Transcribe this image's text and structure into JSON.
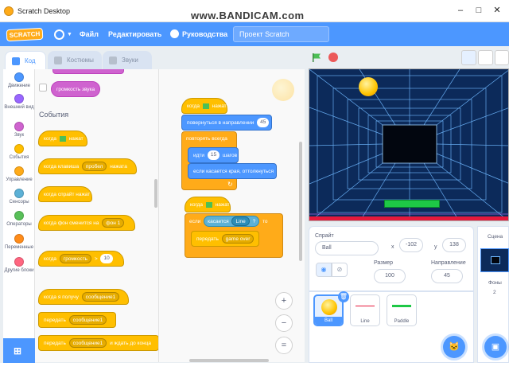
{
  "window": {
    "title": "Scratch Desktop",
    "watermark": "www.BANDICAM.com",
    "min": "–",
    "max": "□",
    "close": "✕"
  },
  "menu": {
    "logo": "SCRATCH",
    "file": "Файл",
    "edit": "Редактировать",
    "tutorials": "Руководства",
    "project_title": "Проект Scratch"
  },
  "tabs": {
    "code": "Код",
    "costumes": "Костюмы",
    "sounds": "Звуки"
  },
  "categories": [
    {
      "label": "Движение",
      "color": "#4c97ff"
    },
    {
      "label": "Внешний вид",
      "color": "#9966ff"
    },
    {
      "label": "Звук",
      "color": "#cf63cf"
    },
    {
      "label": "События",
      "color": "#ffbf00"
    },
    {
      "label": "Управление",
      "color": "#ffab19"
    },
    {
      "label": "Сенсоры",
      "color": "#5cb1d6"
    },
    {
      "label": "Операторы",
      "color": "#59c059"
    },
    {
      "label": "Переменные",
      "color": "#ff8c1a"
    },
    {
      "label": "Другие блоки",
      "color": "#ff6680"
    }
  ],
  "palette": {
    "volume_reporter": "громкость звука",
    "events_heading": "События",
    "when_flag": "когда",
    "when_flag_tail": "нажат",
    "when_key": "когда клавиша",
    "key_value": "пробел",
    "key_tail": "нажата",
    "when_sprite_clicked": "когда спрайт нажат",
    "when_backdrop": "когда фон сменится на",
    "backdrop_value": "фон 1",
    "when_greater": "когда",
    "greater_value": "громкость",
    "greater_op": ">",
    "greater_num": "10",
    "when_receive": "когда я получу",
    "message_value": "сообщение1",
    "broadcast": "передать",
    "broadcast_value": "сообщение1",
    "broadcast_wait": "передать",
    "broadcast_wait_value": "сообщение1",
    "broadcast_wait_tail": "и ждать до конца"
  },
  "script": {
    "s1_hat": "когда",
    "s1_hat_tail": "нажат",
    "s1_point": "повернуться в направлении",
    "s1_point_val": "45",
    "s1_forever": "повторять всегда",
    "s1_move": "идти",
    "s1_move_val": "15",
    "s1_move_tail": "шагов",
    "s1_bounce": "если касается края, оттолкнуться",
    "s2_hat": "когда",
    "s2_hat_tail": "нажат",
    "s2_if": "если",
    "s2_touching": "касается",
    "s2_touching_val": "Line",
    "s2_q": "?",
    "s2_then": "то",
    "s2_broadcast": "передать",
    "s2_broadcast_val": "game over",
    "zoom_in": "+",
    "zoom_out": "−",
    "zoom_reset": "="
  },
  "sprite": {
    "label": "Спрайт",
    "name": "Ball",
    "x_label": "x",
    "x": "-102",
    "y_label": "y",
    "y": "138",
    "show_label": "Показать",
    "size_label": "Размер",
    "size": "100",
    "direction_label": "Направление",
    "direction": "45"
  },
  "sprites": [
    {
      "name": "Ball"
    },
    {
      "name": "Line"
    },
    {
      "name": "Paddle"
    }
  ],
  "stage_panel": {
    "title": "Сцена",
    "backdrops_label": "Фоны",
    "backdrops_count": "2"
  },
  "colors": {
    "accent": "#4c97ff",
    "events": "#ffbf00",
    "control": "#ffab19",
    "motion": "#4c97ff",
    "sensing": "#5cb1d6",
    "paddle": "#1ec846",
    "line": "#e6193c"
  }
}
